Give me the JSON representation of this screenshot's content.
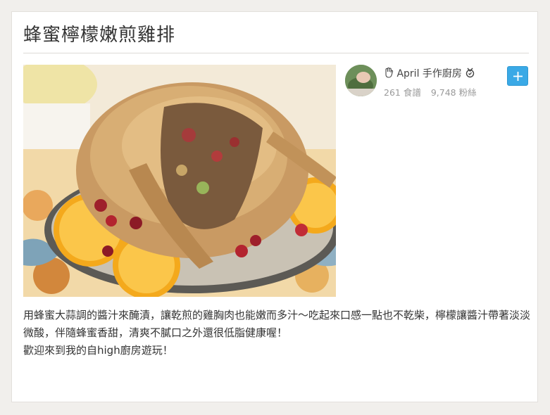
{
  "recipe": {
    "title": "蜂蜜檸檬嫩煎雞排",
    "description": [
      "用蜂蜜大蒜調的醬汁來醃漬，讓乾煎的雞胸肉也能嫩而多汁～吃起來口感一點也不乾柴，檸檬讓醬汁帶著淡淡微酸，伴隨蜂蜜香甜，清爽不膩口之外還很低脂健康喔！",
      "歡迎來到我的自high廚房遊玩！"
    ]
  },
  "author": {
    "name": "April 手作廚房",
    "recipes_count": "261 食譜",
    "fans_count": "9,748 粉絲",
    "name_prefix_icon": "hand-wave-icon",
    "name_suffix_icon": "badge-icon",
    "follow_icon": "plus-icon"
  },
  "colors": {
    "accent": "#3aa9e6",
    "title_text": "#333333",
    "muted_text": "#9a9a9a",
    "page_background": "#f1efec"
  }
}
